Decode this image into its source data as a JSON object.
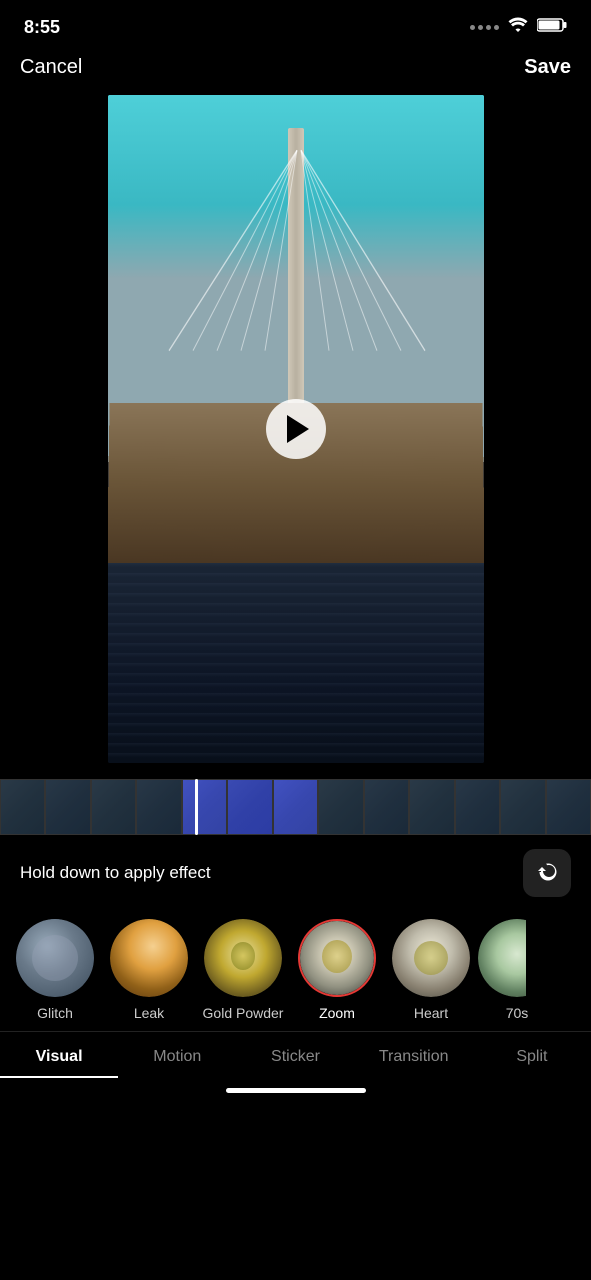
{
  "statusBar": {
    "time": "8:55",
    "wifi": "wifi",
    "battery": "battery"
  },
  "nav": {
    "cancelLabel": "Cancel",
    "saveLabel": "Save"
  },
  "video": {
    "playButton": "play"
  },
  "timeline": {
    "instructionText": "Hold down to apply effect"
  },
  "effects": [
    {
      "id": "glitch",
      "label": "Glitch",
      "thumbClass": "thumb-glitch",
      "selected": false
    },
    {
      "id": "leak",
      "label": "Leak",
      "thumbClass": "thumb-leak",
      "selected": false
    },
    {
      "id": "gold-powder",
      "label": "Gold Powder",
      "thumbClass": "thumb-goldpowder",
      "selected": false
    },
    {
      "id": "zoom",
      "label": "Zoom",
      "thumbClass": "thumb-zoom",
      "selected": true
    },
    {
      "id": "heart",
      "label": "Heart",
      "thumbClass": "thumb-heart",
      "selected": false
    },
    {
      "id": "70s",
      "label": "70s",
      "thumbClass": "thumb-70s",
      "selected": false,
      "partial": true
    }
  ],
  "tabs": [
    {
      "id": "visual",
      "label": "Visual",
      "active": true
    },
    {
      "id": "motion",
      "label": "Motion",
      "active": false
    },
    {
      "id": "sticker",
      "label": "Sticker",
      "active": false
    },
    {
      "id": "transition",
      "label": "Transition",
      "active": false
    },
    {
      "id": "split",
      "label": "Split",
      "active": false
    }
  ]
}
